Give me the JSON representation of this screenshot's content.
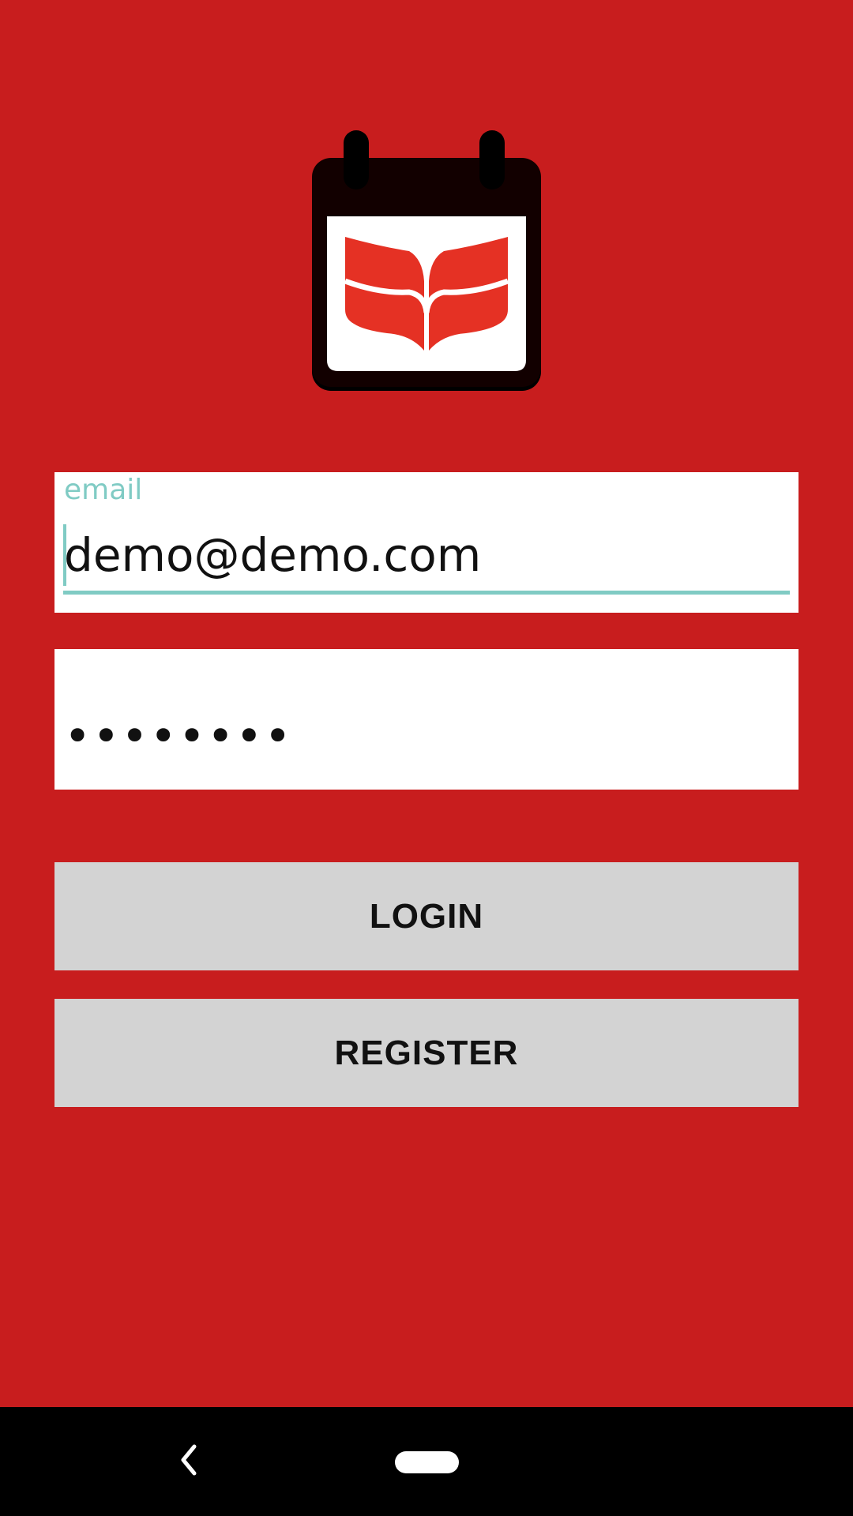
{
  "app": {
    "background_color": "#c81d1e",
    "logo_icon": "calendar-book-logo-icon"
  },
  "login_form": {
    "email_label": "email",
    "email_value": "demo@demo.com",
    "password_value": "••••••••",
    "accent_color": "#80cbc4"
  },
  "buttons": {
    "login_label": "LOGIN",
    "register_label": "REGISTER"
  },
  "navbar": {
    "back_icon": "back-chevron-icon",
    "home_icon": "home-pill-icon"
  }
}
